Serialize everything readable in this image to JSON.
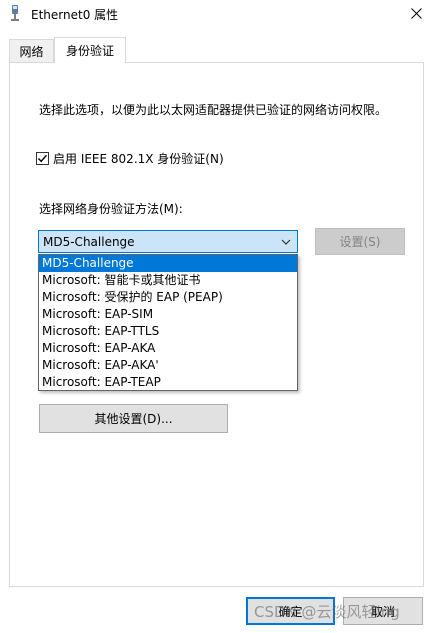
{
  "window": {
    "title": "Ethernet0 属性",
    "icon": "network-adapter-icon",
    "close_icon": "close-icon"
  },
  "tabs": [
    {
      "label": "网络",
      "active": false
    },
    {
      "label": "身份验证",
      "active": true
    }
  ],
  "auth": {
    "description": "选择此选项，以便为此以太网适配器提供已验证的网络访问权限。",
    "checkbox_label": "启用 IEEE 802.1X 身份验证(N)",
    "checkbox_checked": true,
    "method_label": "选择网络身份验证方法(M):",
    "selected_method": "MD5-Challenge",
    "settings_button": "设置(S)",
    "settings_enabled": false,
    "methods": [
      "MD5-Challenge",
      "Microsoft: 智能卡或其他证书",
      "Microsoft: 受保护的 EAP (PEAP)",
      "Microsoft: EAP-SIM",
      "Microsoft: EAP-TTLS",
      "Microsoft: EAP-AKA",
      "Microsoft: EAP-AKA'",
      "Microsoft: EAP-TEAP"
    ],
    "highlighted_method_index": 0,
    "other_settings_button": "其他设置(D)..."
  },
  "footer": {
    "ok_button": "确定",
    "cancel_button": "取消"
  },
  "watermark": "CSDN @云淡风轻ing",
  "colors": {
    "accent": "#0078d7",
    "combo_bg": "#cce4f7",
    "disabled_text": "#838383"
  }
}
